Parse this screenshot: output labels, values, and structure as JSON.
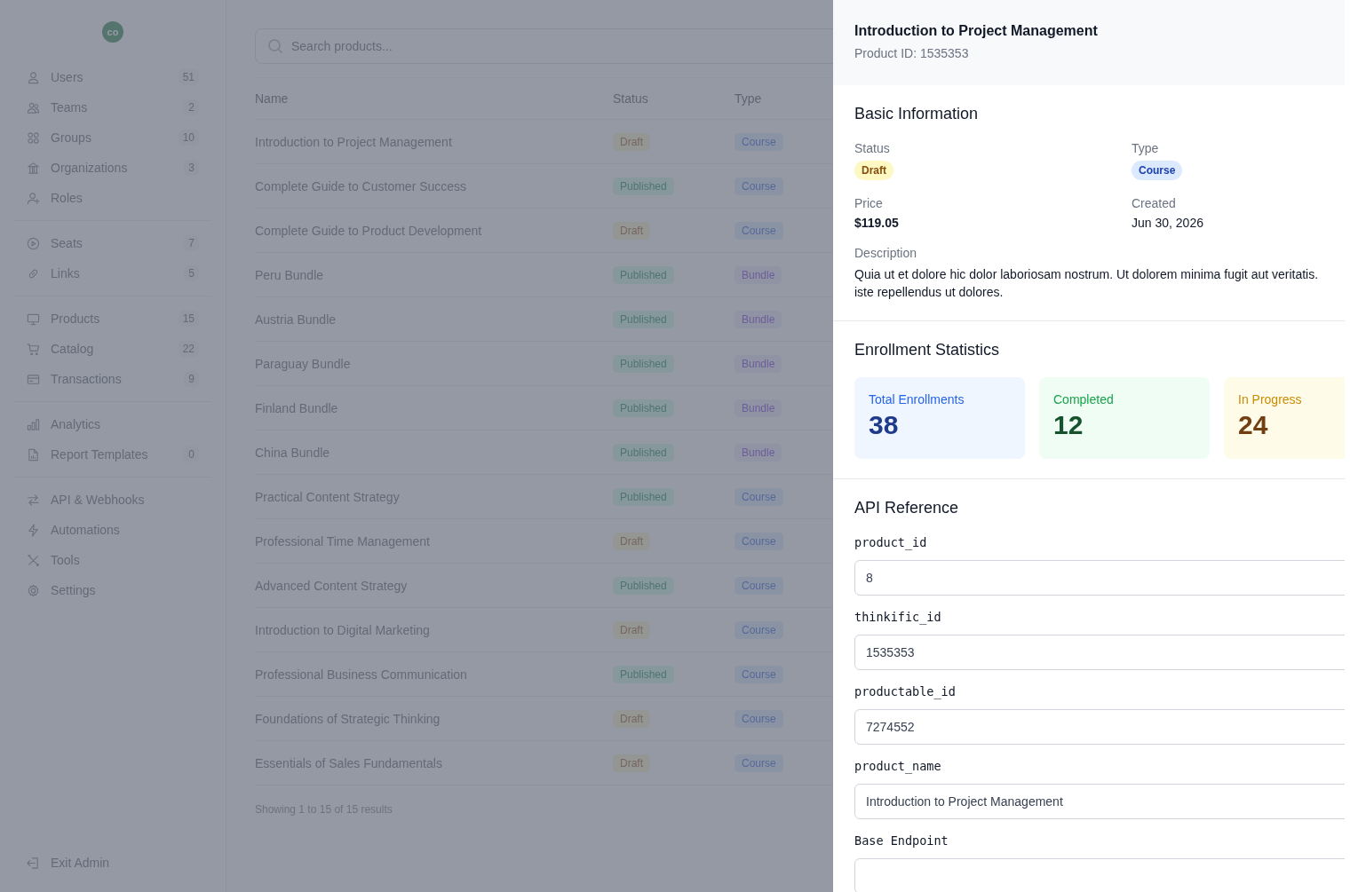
{
  "sidebar": {
    "avatar": "co",
    "groups": [
      {
        "items": [
          {
            "label": "Users",
            "count": "51"
          },
          {
            "label": "Teams",
            "count": "2"
          },
          {
            "label": "Groups",
            "count": "10"
          },
          {
            "label": "Organizations",
            "count": "3"
          },
          {
            "label": "Roles"
          }
        ]
      },
      {
        "items": [
          {
            "label": "Seats",
            "count": "7"
          },
          {
            "label": "Links",
            "count": "5"
          }
        ]
      },
      {
        "items": [
          {
            "label": "Products",
            "count": "15"
          },
          {
            "label": "Catalog",
            "count": "22"
          },
          {
            "label": "Transactions",
            "count": "9"
          }
        ]
      },
      {
        "items": [
          {
            "label": "Analytics"
          },
          {
            "label": "Report Templates",
            "count": "0"
          }
        ]
      },
      {
        "items": [
          {
            "label": "API & Webhooks"
          },
          {
            "label": "Automations"
          },
          {
            "label": "Tools"
          },
          {
            "label": "Settings"
          }
        ]
      }
    ],
    "footer": "Exit Admin"
  },
  "search": {
    "placeholder": "Search products..."
  },
  "table": {
    "columns": [
      "Name",
      "Status",
      "Type"
    ],
    "rows": [
      {
        "name": "Introduction to Project Management",
        "status": {
          "label": "Draft",
          "kind": "draft"
        },
        "type": {
          "label": "Course",
          "kind": "course"
        }
      },
      {
        "name": "Complete Guide to Customer Success",
        "status": {
          "label": "Published",
          "kind": "published"
        },
        "type": {
          "label": "Course",
          "kind": "course"
        }
      },
      {
        "name": "Complete Guide to Product Development",
        "status": {
          "label": "Draft",
          "kind": "draft"
        },
        "type": {
          "label": "Course",
          "kind": "course"
        }
      },
      {
        "name": "Peru Bundle",
        "status": {
          "label": "Published",
          "kind": "published"
        },
        "type": {
          "label": "Bundle",
          "kind": "bundle"
        }
      },
      {
        "name": "Austria Bundle",
        "status": {
          "label": "Published",
          "kind": "published"
        },
        "type": {
          "label": "Bundle",
          "kind": "bundle"
        }
      },
      {
        "name": "Paraguay Bundle",
        "status": {
          "label": "Published",
          "kind": "published"
        },
        "type": {
          "label": "Bundle",
          "kind": "bundle"
        }
      },
      {
        "name": "Finland Bundle",
        "status": {
          "label": "Published",
          "kind": "published"
        },
        "type": {
          "label": "Bundle",
          "kind": "bundle"
        }
      },
      {
        "name": "China Bundle",
        "status": {
          "label": "Published",
          "kind": "published"
        },
        "type": {
          "label": "Bundle",
          "kind": "bundle"
        }
      },
      {
        "name": "Practical Content Strategy",
        "status": {
          "label": "Published",
          "kind": "published"
        },
        "type": {
          "label": "Course",
          "kind": "course"
        }
      },
      {
        "name": "Professional Time Management",
        "status": {
          "label": "Draft",
          "kind": "draft"
        },
        "type": {
          "label": "Course",
          "kind": "course"
        }
      },
      {
        "name": "Advanced Content Strategy",
        "status": {
          "label": "Published",
          "kind": "published"
        },
        "type": {
          "label": "Course",
          "kind": "course"
        }
      },
      {
        "name": "Introduction to Digital Marketing",
        "status": {
          "label": "Draft",
          "kind": "draft"
        },
        "type": {
          "label": "Course",
          "kind": "course"
        }
      },
      {
        "name": "Professional Business Communication",
        "status": {
          "label": "Published",
          "kind": "published"
        },
        "type": {
          "label": "Course",
          "kind": "course"
        }
      },
      {
        "name": "Foundations of Strategic Thinking",
        "status": {
          "label": "Draft",
          "kind": "draft"
        },
        "type": {
          "label": "Course",
          "kind": "course"
        }
      },
      {
        "name": "Essentials of Sales Fundamentals",
        "status": {
          "label": "Draft",
          "kind": "draft"
        },
        "type": {
          "label": "Course",
          "kind": "course"
        }
      }
    ],
    "footer": "Showing 1 to 15 of 15 results"
  },
  "panel": {
    "title": "Introduction to Project Management",
    "subtitle": "Product ID: 1535353",
    "basic": {
      "heading": "Basic Information",
      "status_label": "Status",
      "status": {
        "label": "Draft",
        "kind": "draft"
      },
      "type_label": "Type",
      "type": {
        "label": "Course",
        "kind": "course"
      },
      "price_label": "Price",
      "price": "$119.05",
      "created_label": "Created",
      "created": "Jun 30, 2026",
      "description_label": "Description",
      "description": "Quia ut et dolore hic dolor laboriosam nostrum. Ut dolorem minima fugit aut veritatis.\niste repellendus ut dolores."
    },
    "stats": {
      "heading": "Enrollment Statistics",
      "cards": [
        {
          "label": "Total Enrollments",
          "value": "38",
          "kind": "blue"
        },
        {
          "label": "Completed",
          "value": "12",
          "kind": "green"
        },
        {
          "label": "In Progress",
          "value": "24",
          "kind": "yellow"
        }
      ]
    },
    "api": {
      "heading": "API Reference",
      "fields": [
        {
          "label": "product_id",
          "value": "8"
        },
        {
          "label": "thinkific_id",
          "value": "1535353"
        },
        {
          "label": "productable_id",
          "value": "7274552"
        },
        {
          "label": "product_name",
          "value": "Introduction to Project Management"
        },
        {
          "label": "Base Endpoint"
        }
      ]
    }
  }
}
